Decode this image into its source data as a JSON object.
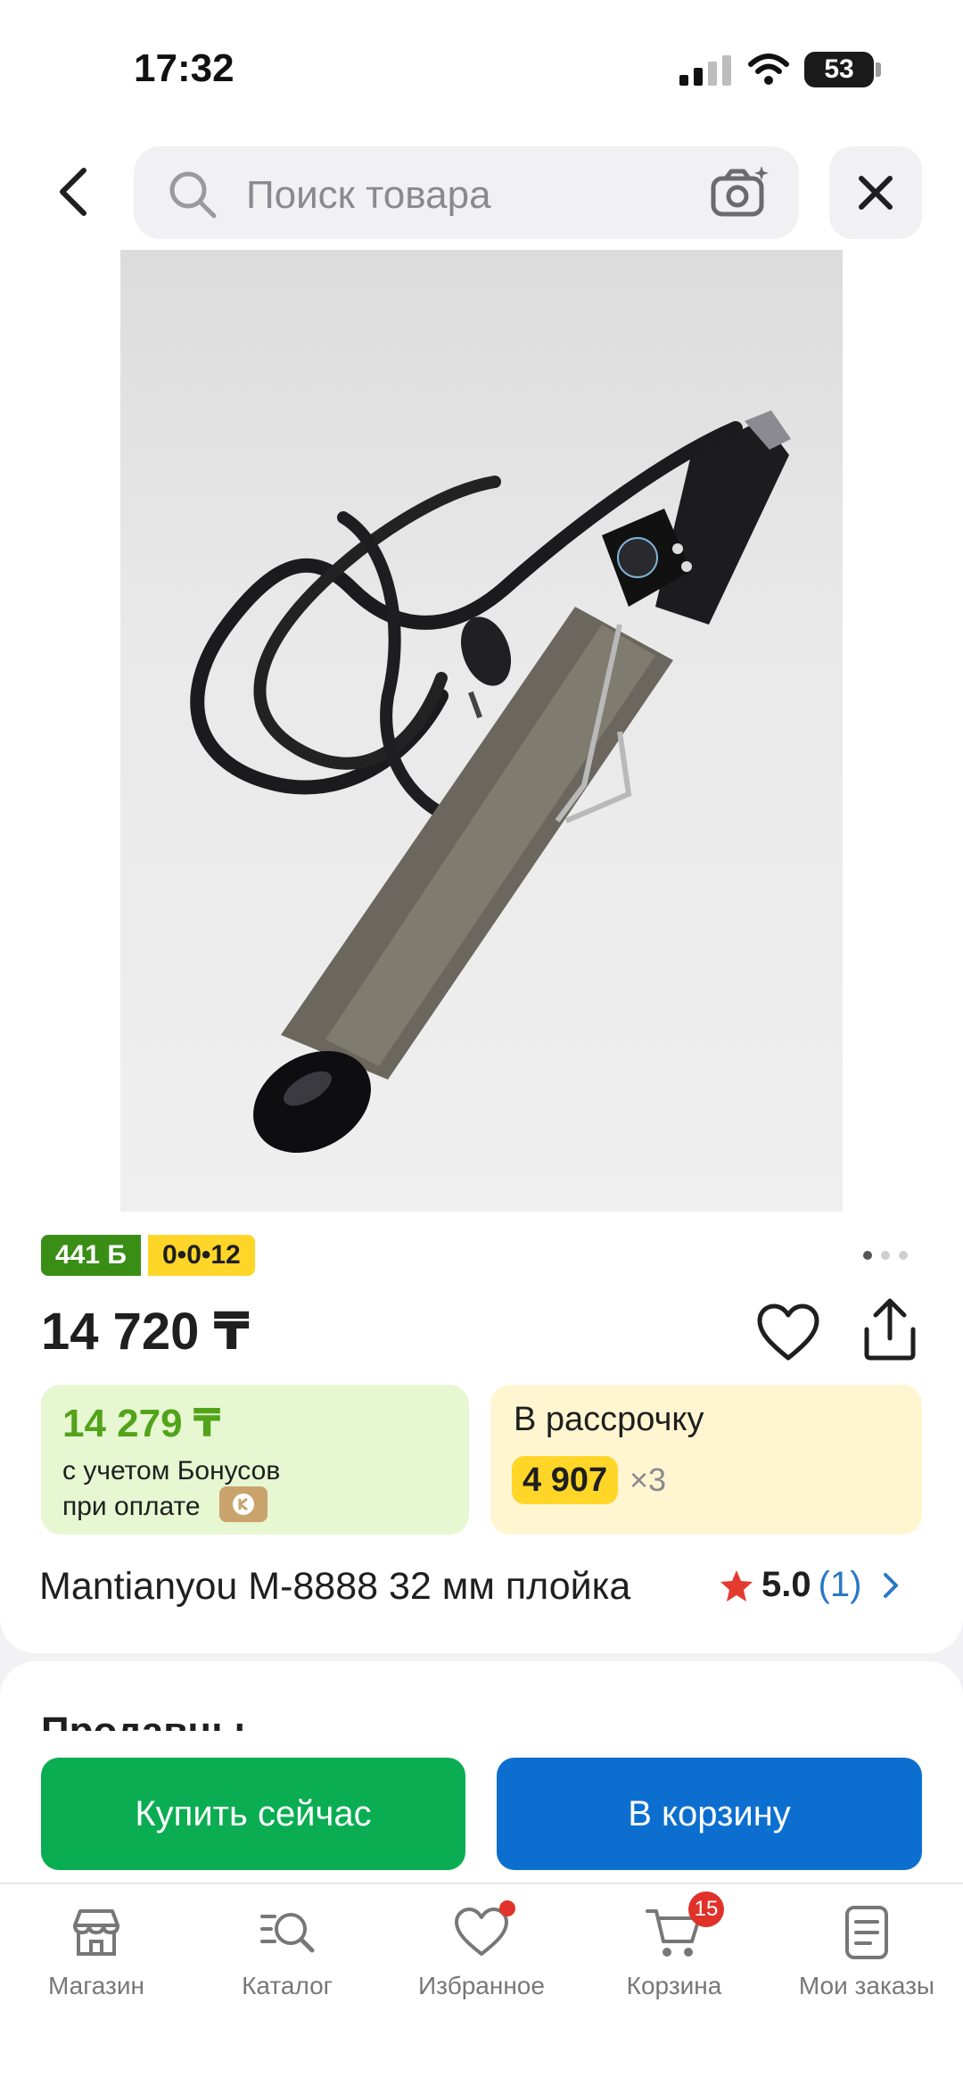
{
  "status_bar": {
    "time": "17:32",
    "battery": "53"
  },
  "search": {
    "placeholder": "Поиск товара"
  },
  "product": {
    "bonus_badge": "441 Б",
    "installment_badge": "0•0•12",
    "price": "14 720 ₸",
    "bonus_price": "14 279 ₸",
    "bonus_line1": "с учетом Бонусов",
    "bonus_line2": "при оплате",
    "installment_title": "В рассрочку",
    "installment_amount": "4 907",
    "installment_times": "×3",
    "title": "Mantianyou M-8888 32 мм плойка",
    "rating_value": "5.0",
    "rating_count": "(1)"
  },
  "sellers": {
    "title": "Продавцы"
  },
  "actions": {
    "buy_label": "Купить сейчас",
    "cart_label": "В корзину"
  },
  "tabbar": {
    "items": [
      {
        "label": "Магазин",
        "icon": "store-icon"
      },
      {
        "label": "Каталог",
        "icon": "catalog-search-icon"
      },
      {
        "label": "Избранное",
        "icon": "heart-icon"
      },
      {
        "label": "Корзина",
        "icon": "cart-icon",
        "badge": "15"
      },
      {
        "label": "Мои заказы",
        "icon": "orders-icon"
      }
    ]
  },
  "colors": {
    "green_button": "#0aad52",
    "blue_button": "#0c6fcf",
    "bonus_green": "#52a319",
    "installment_yellow": "#ffd628",
    "badge_red": "#e0322a"
  },
  "gallery": {
    "pages": 3,
    "active_page": 1
  }
}
